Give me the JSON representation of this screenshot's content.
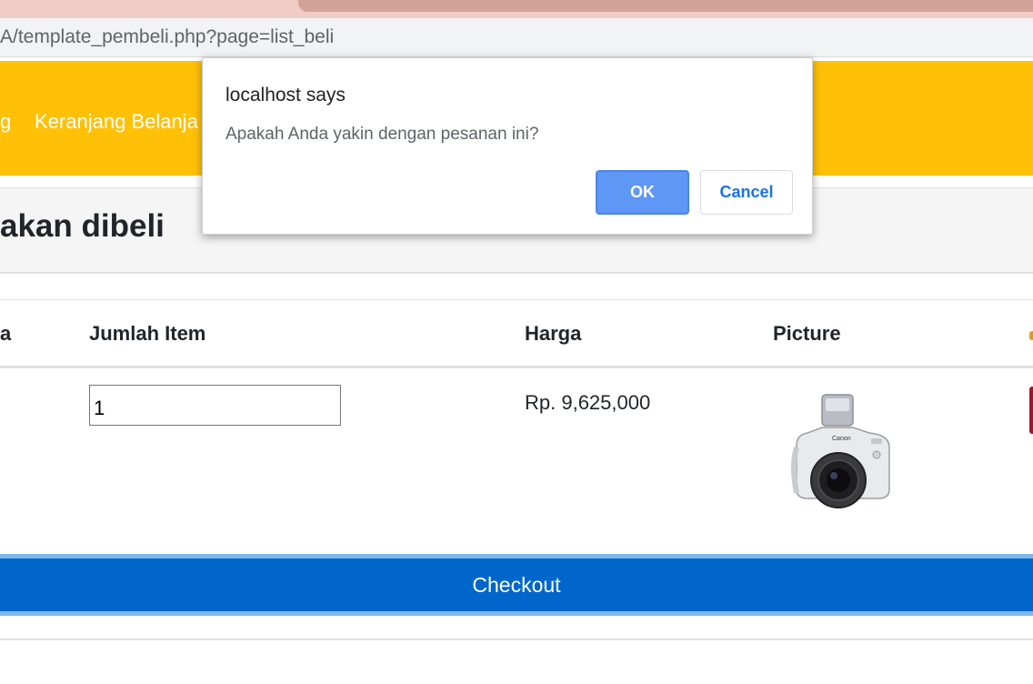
{
  "browser": {
    "url": "A/template_pembeli.php?page=list_beli"
  },
  "navbar": {
    "prev_link_fragment": "g",
    "cart_link": "Keranjang Belanja"
  },
  "section": {
    "title": "akan dibeli"
  },
  "table": {
    "headers": {
      "first_fragment": "a",
      "quantity": "Jumlah Item",
      "price": "Harga",
      "picture": "Picture"
    },
    "row": {
      "quantity_value": "1",
      "price": "Rp. 9,625,000",
      "picture_icon": "camera-product-image"
    }
  },
  "checkout": {
    "label": "Checkout"
  },
  "dialog": {
    "title": "localhost says",
    "message": "Apakah Anda yakin dengan pesanan ini?",
    "ok_label": "OK",
    "cancel_label": "Cancel"
  },
  "colors": {
    "navbar": "#ffc107",
    "checkout": "#0066cc",
    "ok_button": "#5e97f6",
    "cancel_text": "#1a73e8"
  }
}
